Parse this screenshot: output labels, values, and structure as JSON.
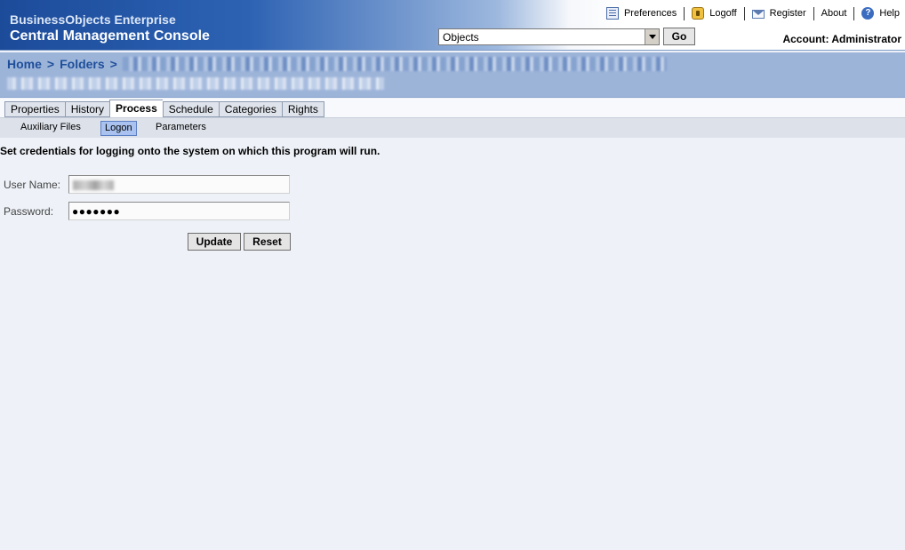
{
  "header": {
    "product_name": "BusinessObjects Enterprise",
    "console_title": "Central Management Console",
    "links": {
      "preferences": "Preferences",
      "logoff": "Logoff",
      "register": "Register",
      "about": "About",
      "help": "Help"
    },
    "object_select_value": "Objects",
    "go_label": "Go",
    "account": "Account: Administrator"
  },
  "breadcrumb": {
    "home": "Home",
    "folders": "Folders",
    "separator": ">"
  },
  "tabs": [
    "Properties",
    "History",
    "Process",
    "Schedule",
    "Categories",
    "Rights"
  ],
  "active_tab": "Process",
  "subtabs": [
    "Auxiliary Files",
    "Logon",
    "Parameters"
  ],
  "active_subtab": "Logon",
  "form": {
    "instructions": "Set credentials for logging onto the system on which this program will run.",
    "username_label": "User Name:",
    "password_label": "Password:",
    "password_mask": "●●●●●●●",
    "update_label": "Update",
    "reset_label": "Reset"
  },
  "icons": {
    "preferences": "preferences-icon",
    "logoff": "logoff-icon",
    "register": "register-envelope-icon",
    "help": "help-icon"
  }
}
